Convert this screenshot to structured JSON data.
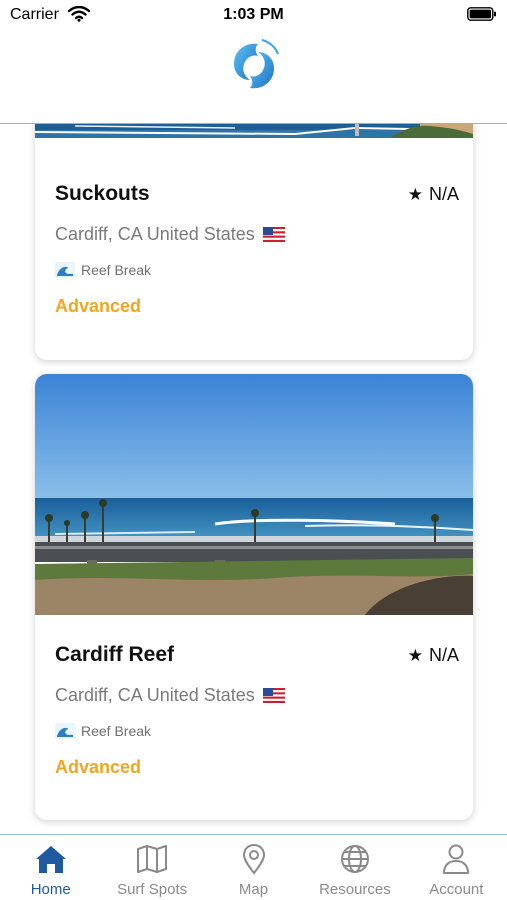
{
  "status_bar": {
    "carrier": "Carrier",
    "time": "1:03 PM"
  },
  "header": {
    "logo_icon": "surf-swirl-logo-icon",
    "brand_color": "#2b8fd6"
  },
  "spots": [
    {
      "name": "Suckouts",
      "rating": "N/A",
      "location": "Cardiff, CA United States",
      "country_flag": "us-flag-icon",
      "break_type": "Reef Break",
      "level": "Advanced"
    },
    {
      "name": "Cardiff Reef",
      "rating": "N/A",
      "location": "Cardiff, CA United States",
      "country_flag": "us-flag-icon",
      "break_type": "Reef Break",
      "level": "Advanced"
    }
  ],
  "tabs": [
    {
      "label": "Home",
      "icon": "home-icon",
      "active": true
    },
    {
      "label": "Surf Spots",
      "icon": "map-icon",
      "active": false
    },
    {
      "label": "Map",
      "icon": "location-pin-icon",
      "active": false
    },
    {
      "label": "Resources",
      "icon": "globe-icon",
      "active": false
    },
    {
      "label": "Account",
      "icon": "person-icon",
      "active": false
    }
  ],
  "colors": {
    "accent": "#1f5aa0",
    "level_advanced": "#f2a51e",
    "inactive_tab": "#8a8a8a"
  }
}
